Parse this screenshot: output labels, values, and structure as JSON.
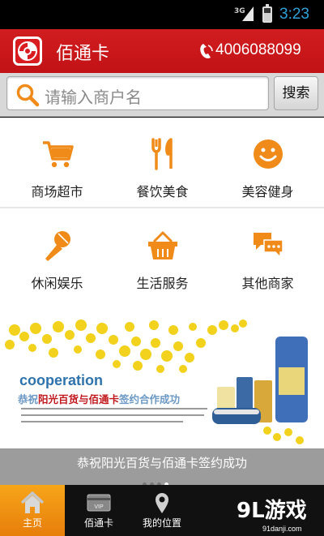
{
  "status_bar": {
    "network": "3G",
    "time": "3:23"
  },
  "header": {
    "app_title": "佰通卡",
    "phone_number": "4006088099"
  },
  "search": {
    "placeholder": "请输入商户名",
    "button_label": "搜索"
  },
  "categories": [
    {
      "label": "商场超市",
      "icon": "shopping-cart-icon"
    },
    {
      "label": "餐饮美食",
      "icon": "fork-knife-icon"
    },
    {
      "label": "美容健身",
      "icon": "smiley-icon"
    },
    {
      "label": "休闲娱乐",
      "icon": "microphone-icon"
    },
    {
      "label": "生活服务",
      "icon": "basket-icon"
    },
    {
      "label": "其他商家",
      "icon": "chat-bubbles-icon"
    }
  ],
  "banner": {
    "heading": "cooperation",
    "title_pre": "恭祝",
    "title_highlight": "阳光百货与佰通卡",
    "title_post": "签约合作成功",
    "caption": "恭祝阳光百货与佰通卡签约成功",
    "slide_count": 4,
    "active_slide": 4
  },
  "tabs": [
    {
      "label": "主页",
      "icon": "home-icon",
      "active": true
    },
    {
      "label": "佰通卡",
      "icon": "vip-card-icon",
      "active": false
    },
    {
      "label": "我的位置",
      "icon": "location-pin-icon",
      "active": false
    }
  ],
  "watermark": {
    "brand": "9L游戏",
    "site": "91danji.com"
  },
  "colors": {
    "header_red": "#c8181b",
    "accent_orange": "#f08a18",
    "tab_active": "#f29a15"
  }
}
